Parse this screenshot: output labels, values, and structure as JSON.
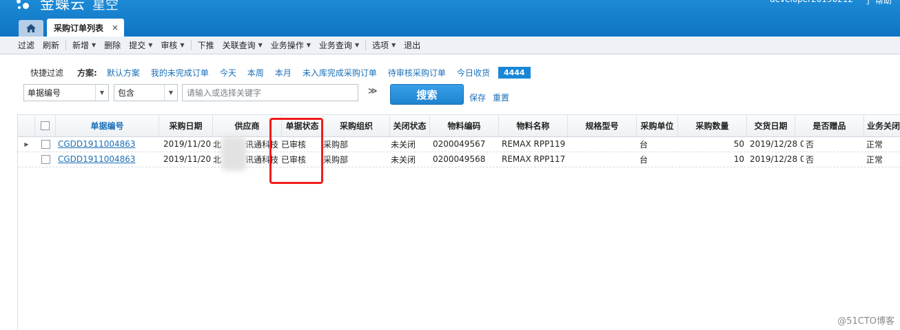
{
  "header": {
    "logo_text": "金蝶云",
    "logo_sub": "星空",
    "user": "developer20190212",
    "user_link": "了 帮助"
  },
  "tabs": {
    "home_icon": "home-icon",
    "active_label": "采购订单列表",
    "close_symbol": "×"
  },
  "menu": [
    {
      "label": "过滤",
      "dropdown": false
    },
    {
      "label": "刷新",
      "dropdown": false
    },
    {
      "label": "新增",
      "dropdown": true
    },
    {
      "label": "删除",
      "dropdown": false
    },
    {
      "label": "提交",
      "dropdown": true
    },
    {
      "label": "审核",
      "dropdown": true
    },
    {
      "label": "下推",
      "dropdown": false
    },
    {
      "label": "关联查询",
      "dropdown": true
    },
    {
      "label": "业务操作",
      "dropdown": true
    },
    {
      "label": "业务查询",
      "dropdown": true
    },
    {
      "label": "选项",
      "dropdown": true
    },
    {
      "label": "退出",
      "dropdown": false
    }
  ],
  "quick_filter": {
    "label": "快捷过滤",
    "plan_label": "方案:",
    "plans": [
      "默认方案",
      "我的未完成订单",
      "今天",
      "本周",
      "本月",
      "未入库完成采购订单",
      "待审核采购订单",
      "今日收货"
    ],
    "badge": "4444"
  },
  "search": {
    "field": "单据编号",
    "operator": "包含",
    "placeholder": "请输入或选择关键字",
    "expand_symbol": "≫",
    "search_label": "搜索",
    "save_label": "保存",
    "reset_label": "重置"
  },
  "grid": {
    "columns": [
      "单据编号",
      "采购日期",
      "供应商",
      "单据状态",
      "采购组织",
      "关闭状态",
      "物料编码",
      "物料名称",
      "规格型号",
      "采购单位",
      "采购数量",
      "交货日期",
      "是否赠品",
      "业务关闭"
    ],
    "rows": [
      {
        "bill_no": "CGDD1911004863",
        "date": "2019/11/20",
        "supplier": "北",
        "supplier2": "讯通科技",
        "status": "已审核",
        "org": "采购部",
        "close": "未关闭",
        "material_code": "0200049567",
        "material_name": "REMAX RPP119 ·",
        "spec": "",
        "unit": "台",
        "qty": "50",
        "delivery": "2019/12/28 0",
        "gift": "否",
        "biz_close": "正常"
      },
      {
        "bill_no": "CGDD1911004863",
        "date": "2019/11/20",
        "supplier": "北",
        "supplier2": "讯通科技",
        "status": "已审核",
        "org": "采购部",
        "close": "未关闭",
        "material_code": "0200049568",
        "material_name": "REMAX RPP117 ·",
        "spec": "",
        "unit": "台",
        "qty": "10",
        "delivery": "2019/12/28 0",
        "gift": "否",
        "biz_close": "正常"
      }
    ]
  },
  "watermark": "@51CTO博客",
  "colors": {
    "accent": "#1987d6",
    "highlight_box": "#ee1c1c",
    "link": "#1a6fb8"
  }
}
